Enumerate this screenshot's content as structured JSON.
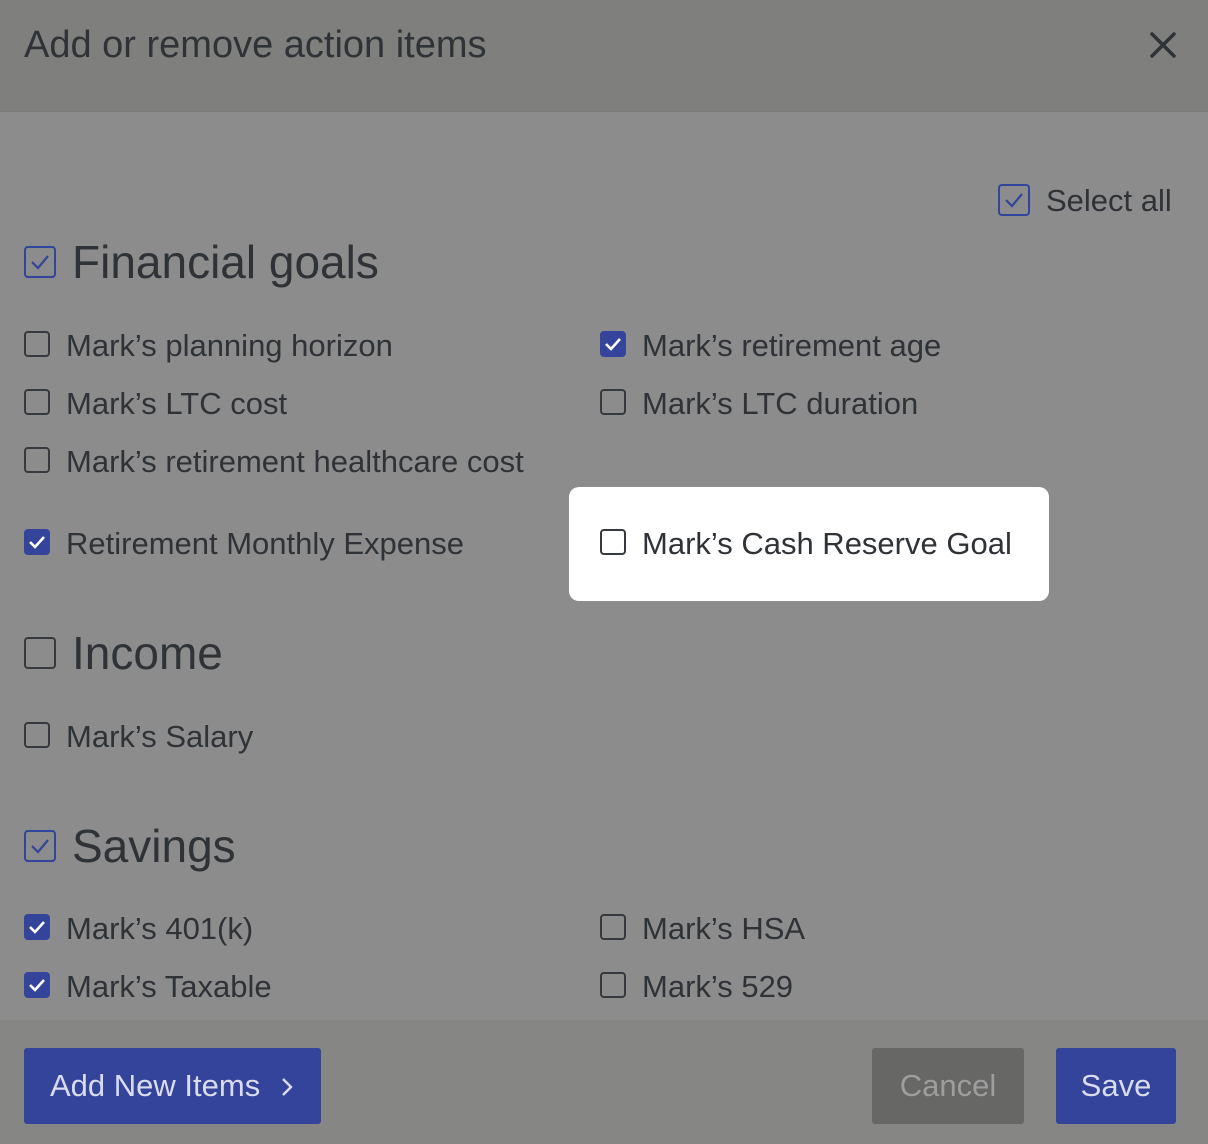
{
  "dialog": {
    "title": "Add or remove action items",
    "close_icon": "close-icon"
  },
  "select_all": {
    "label": "Select all",
    "checked": true
  },
  "sections": [
    {
      "title": "Financial goals",
      "checked": true,
      "items": [
        {
          "label": "Mark’s planning horizon",
          "checked": false
        },
        {
          "label": "Mark’s retirement age",
          "checked": true
        },
        {
          "label": "Mark’s LTC cost",
          "checked": false
        },
        {
          "label": "Mark’s LTC duration",
          "checked": false
        },
        {
          "label": "Mark’s retirement healthcare cost",
          "checked": false
        },
        {
          "label": "Retirement Monthly Expense",
          "checked": true
        },
        {
          "label": "Mark’s Cash Reserve Goal",
          "checked": false,
          "highlighted": true
        }
      ]
    },
    {
      "title": "Income",
      "checked": false,
      "items": [
        {
          "label": "Mark’s Salary",
          "checked": false
        }
      ]
    },
    {
      "title": "Savings",
      "checked": true,
      "items": [
        {
          "label": "Mark’s 401(k)",
          "checked": true
        },
        {
          "label": "Mark’s HSA",
          "checked": false
        },
        {
          "label": "Mark’s Taxable",
          "checked": true
        },
        {
          "label": "Mark’s 529",
          "checked": false
        }
      ]
    }
  ],
  "footer": {
    "add_new_label": "Add New Items",
    "cancel_label": "Cancel",
    "save_label": "Save"
  },
  "colors": {
    "accent": "#33449a",
    "overlay": "#8c8c8c",
    "highlight": "#ffffff"
  }
}
